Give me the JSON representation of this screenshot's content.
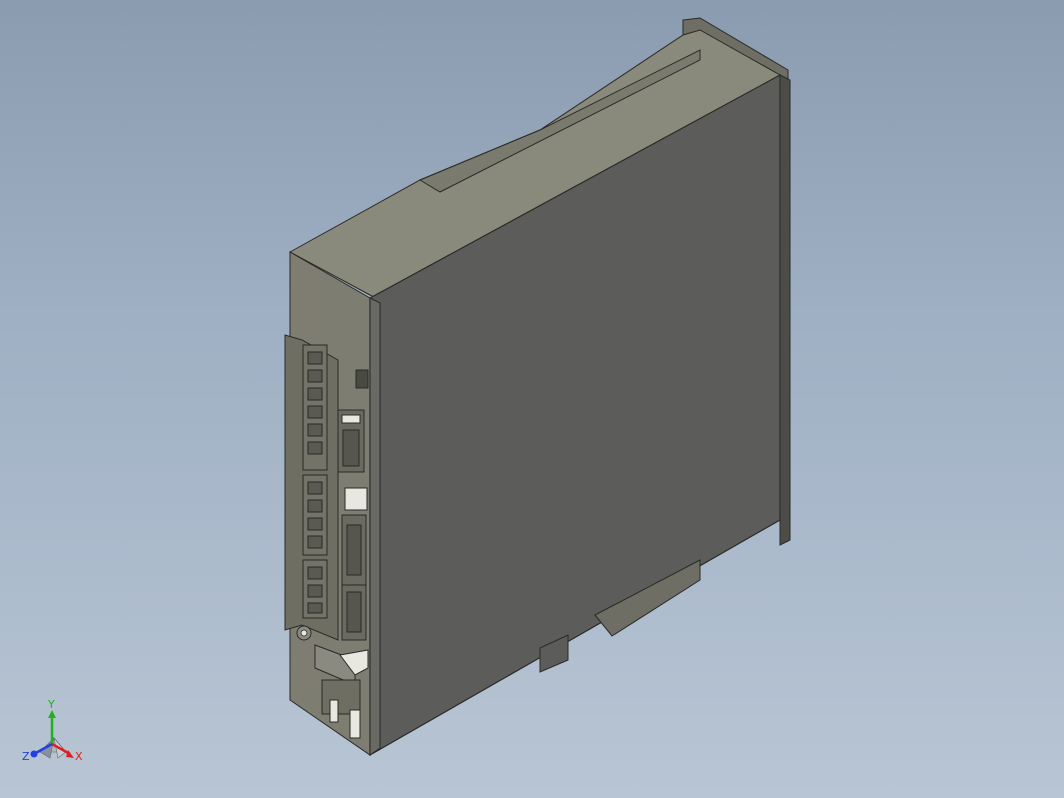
{
  "viewport": {
    "background_top": "#8b9bb0",
    "background_bottom": "#b8c5d4"
  },
  "model": {
    "type": "servo-drive-3d-model",
    "colors": {
      "body_front": "#5c5c5a",
      "body_side": "#7d7d72",
      "body_top": "#8a8a7c",
      "edge": "#2a2a26",
      "connector": "#6e6e62",
      "highlight": "#e8e8e0"
    }
  },
  "triad": {
    "x_label": "X",
    "y_label": "Y",
    "z_label": "Z",
    "x_color": "#e02020",
    "y_color": "#20b020",
    "z_color": "#2040e0"
  }
}
